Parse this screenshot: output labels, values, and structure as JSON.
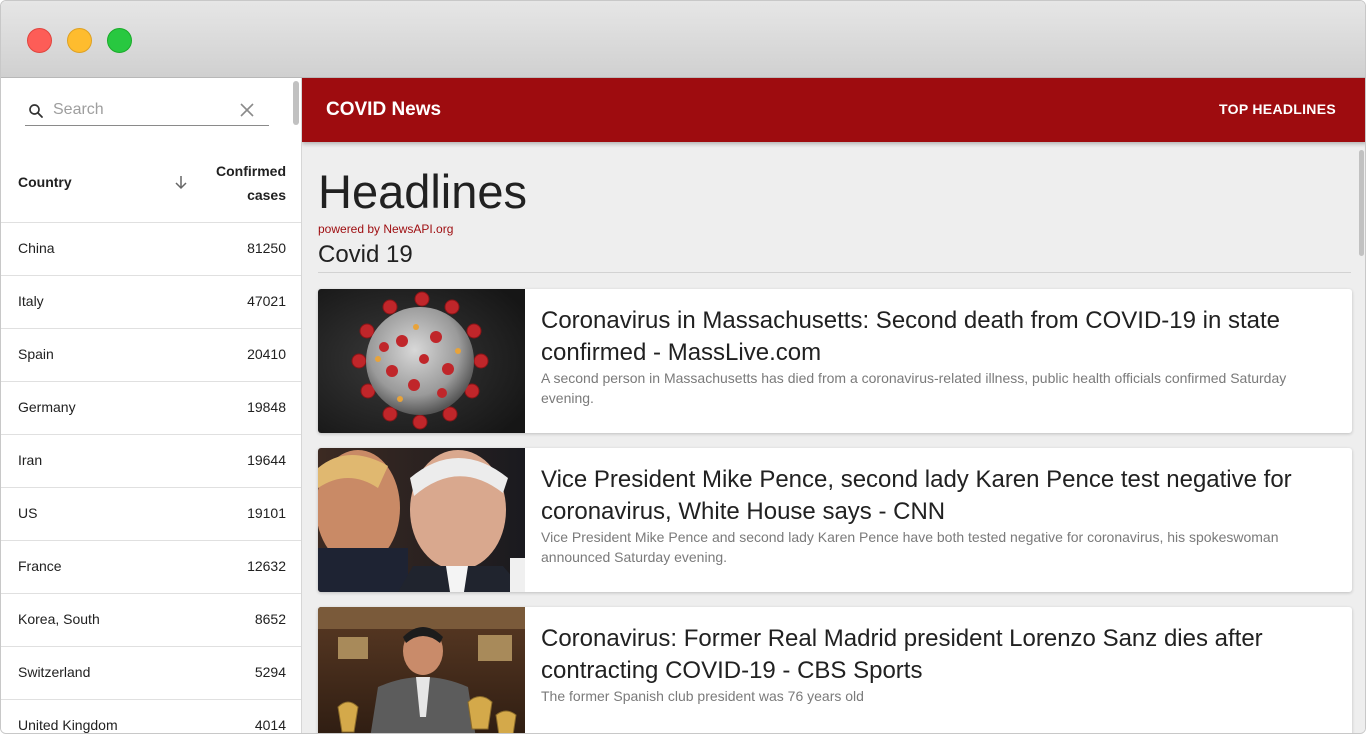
{
  "window": {
    "buttons": [
      "close",
      "minimize",
      "zoom"
    ]
  },
  "sidebar": {
    "search": {
      "placeholder": "Search",
      "value": ""
    },
    "table": {
      "headers": {
        "country": "Country",
        "cases": "Confirmed cases"
      },
      "sort": "descending",
      "rows": [
        {
          "country": "China",
          "cases": "81250"
        },
        {
          "country": "Italy",
          "cases": "47021"
        },
        {
          "country": "Spain",
          "cases": "20410"
        },
        {
          "country": "Germany",
          "cases": "19848"
        },
        {
          "country": "Iran",
          "cases": "19644"
        },
        {
          "country": "US",
          "cases": "19101"
        },
        {
          "country": "France",
          "cases": "12632"
        },
        {
          "country": "Korea, South",
          "cases": "8652"
        },
        {
          "country": "Switzerland",
          "cases": "5294"
        },
        {
          "country": "United Kingdom",
          "cases": "4014"
        }
      ]
    }
  },
  "header": {
    "title": "COVID News",
    "nav_label": "TOP HEADLINES"
  },
  "main": {
    "heading": "Headlines",
    "powered_by": "powered by NewsAPI.org",
    "topic": "Covid 19",
    "articles": [
      {
        "title": "Coronavirus in Massachusetts: Second death from COVID-19 in state confirmed - MassLive.com",
        "description": "A second person in Massachusetts has died from a coronavirus-related illness, public health officials confirmed Saturday evening.",
        "image": "coronavirus-illustration"
      },
      {
        "title": "Vice President Mike Pence, second lady Karen Pence test negative for coronavirus, White House says - CNN",
        "description": "Vice President Mike Pence and second lady Karen Pence have both tested negative for coronavirus, his spokeswoman announced Saturday evening.",
        "image": "press-briefing-photo"
      },
      {
        "title": "Coronavirus: Former Real Madrid president Lorenzo Sanz dies after contracting COVID-19 - CBS Sports",
        "description": "The former Spanish club president was 76 years old",
        "image": "trophy-room-photo"
      }
    ]
  },
  "colors": {
    "accent": "#9e0c0f",
    "background": "#eeeeee"
  },
  "icons": {
    "search": "search-icon",
    "clear": "close-icon",
    "sort": "arrow-down-icon"
  }
}
